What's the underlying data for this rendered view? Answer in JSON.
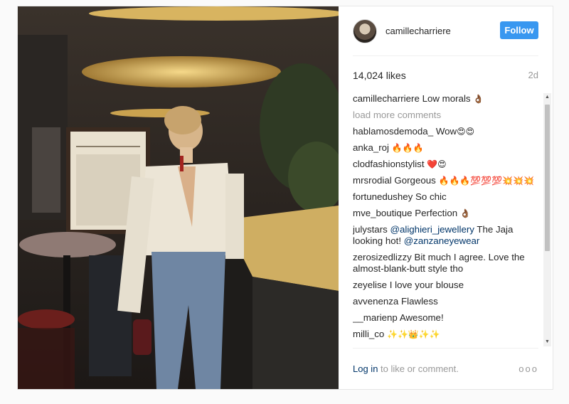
{
  "header": {
    "username": "camillecharriere",
    "follow_label": "Follow"
  },
  "stats": {
    "likes": "14,024 likes",
    "time": "2d"
  },
  "caption": {
    "user": "camillecharriere",
    "text": "Low morals",
    "emoji": "👌🏾"
  },
  "load_more": "load more comments",
  "comments": [
    {
      "user": "hablamosdemoda_",
      "text": "Wow",
      "emoji": "😍😍"
    },
    {
      "user": "anka_roj",
      "text": "",
      "emoji": "🔥🔥🔥"
    },
    {
      "user": "clodfashionstylist",
      "text": "",
      "emoji": "❤️😍"
    },
    {
      "user": "mrsrodial",
      "text": "Gorgeous",
      "emoji": "🔥🔥🔥💯💯💯💥💥💥"
    },
    {
      "user": "fortunedushey",
      "text": "So chic",
      "emoji": ""
    },
    {
      "user": "mve_boutique",
      "text": "Perfection",
      "emoji": "👌🏾"
    },
    {
      "user": "julystars",
      "mention1": "@alighieri_jewellery",
      "text": "The Jaja looking hot!",
      "mention2": "@zanzaneyewear"
    },
    {
      "user": "zerosizedlizzy",
      "text": "Bit much I agree. Love the almost-blank-butt style tho",
      "emoji": ""
    },
    {
      "user": "zeyelise",
      "text": "I love your blouse",
      "emoji": ""
    },
    {
      "user": "avvenenza",
      "text": "Flawless",
      "emoji": ""
    },
    {
      "user": "__marienp",
      "text": "Awesome!",
      "emoji": ""
    },
    {
      "user": "milli_co",
      "text": "",
      "emoji": "✨✨👑✨✨"
    }
  ],
  "footer": {
    "login_link": "Log in",
    "login_text": "to like or comment.",
    "more": "ooo"
  },
  "colors": {
    "accent": "#3897f0",
    "link": "#003569",
    "muted": "#999999"
  }
}
